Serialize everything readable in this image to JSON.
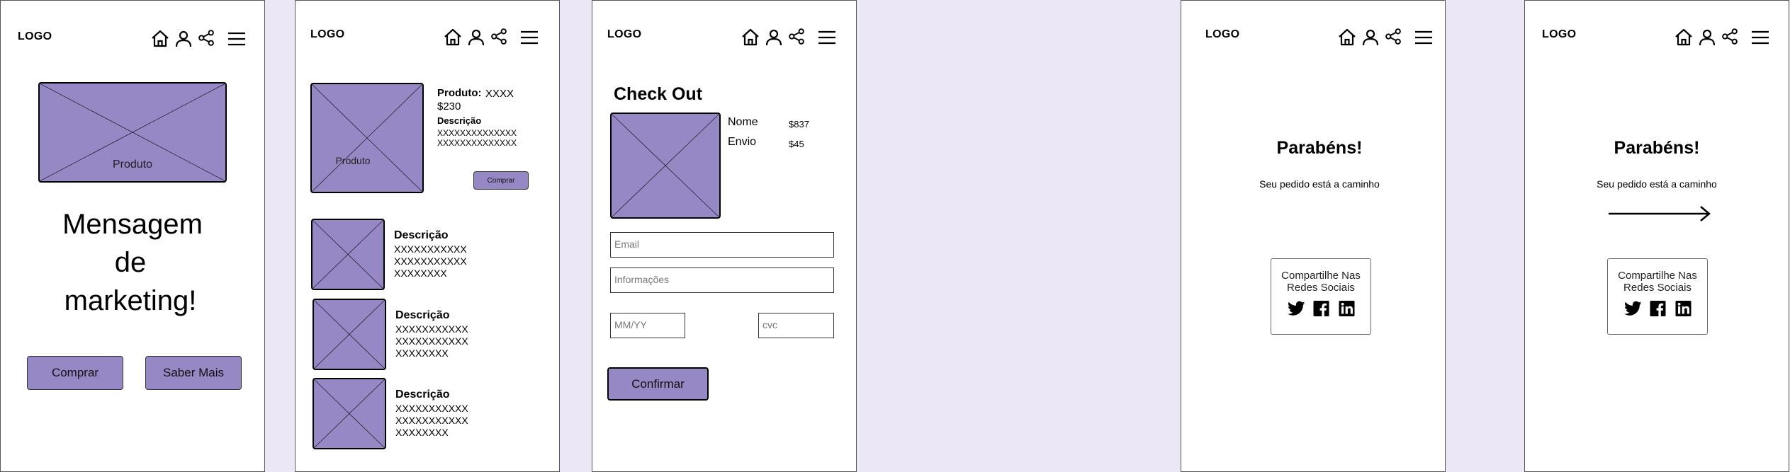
{
  "common": {
    "logo": "LOGO"
  },
  "screen1": {
    "product_label": "Produto",
    "marketing_line1": "Mensagem",
    "marketing_line2": "de",
    "marketing_line3": "marketing!",
    "buy_label": "Comprar",
    "more_label": "Saber Mais"
  },
  "screen2": {
    "product_label": "Produto",
    "product_title": "Produto:",
    "product_name": "XXXX",
    "price": "$230",
    "desc_title": "Descrição",
    "desc_line1": "XXXXXXXXXXXXXX",
    "desc_line2": "XXXXXXXXXXXXXX",
    "buy_label": "Comprar",
    "items": [
      {
        "title": "Descrição",
        "l1": "XXXXXXXXXXX",
        "l2": "XXXXXXXXXXX",
        "l3": "XXXXXXXX"
      },
      {
        "title": "Descrição",
        "l1": "XXXXXXXXXXX",
        "l2": "XXXXXXXXXXX",
        "l3": "XXXXXXXX"
      },
      {
        "title": "Descrição",
        "l1": "XXXXXXXXXXX",
        "l2": "XXXXXXXXXXX",
        "l3": "XXXXXXXX"
      }
    ]
  },
  "screen3": {
    "title": "Check Out",
    "name_label": "Nome",
    "name_value": "$837",
    "ship_label": "Envio",
    "ship_value": "$45",
    "email_placeholder": "Email",
    "info_placeholder": "Informações",
    "expiry_placeholder": "MM/YY",
    "cvc_placeholder": "cvc",
    "confirm_label": "Confirmar"
  },
  "screen4": {
    "title": "Parabéns!",
    "subtitle": "Seu pedido está a caminho",
    "share_line1": "Compartilhe Nas",
    "share_line2": "Redes Sociais"
  },
  "screen5": {
    "title": "Parabéns!",
    "subtitle": "Seu pedido está a caminho",
    "share_line1": "Compartilhe Nas",
    "share_line2": "Redes Sociais"
  },
  "icons": {
    "nav": [
      "home-icon",
      "user-icon",
      "share-icon",
      "menu-icon"
    ],
    "social": [
      "twitter-icon",
      "facebook-icon",
      "linkedin-icon"
    ],
    "arrow": "arrow-right-icon"
  },
  "colors": {
    "background": "#ece7f6",
    "placeholder_fill": "#9688c4",
    "button_fill": "#9688c4",
    "frame_fill": "#ffffff"
  }
}
